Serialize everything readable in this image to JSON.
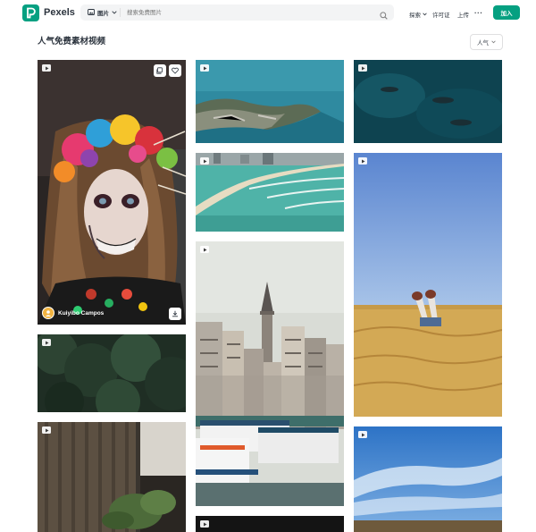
{
  "brand": {
    "name": "Pexels",
    "logo_icon": "pexels-logo-icon",
    "accent": "#05a081"
  },
  "search": {
    "filter_label": "图片",
    "filter_icon": "image-icon",
    "placeholder": "搜索免费图片"
  },
  "nav": {
    "explore": "探索",
    "license": "许可证",
    "upload": "上传",
    "more": "···",
    "join": "加入"
  },
  "page": {
    "title": "人气免费素材视频",
    "sort_label": "人气"
  },
  "tiles": [
    {
      "type": "video",
      "subject": "portrait-skull-makeup",
      "author": "Kuiyibo Campos"
    },
    {
      "type": "video",
      "subject": "forest"
    },
    {
      "type": "video",
      "subject": "curtain-plant"
    },
    {
      "type": "video",
      "subject": "coastline-aerial"
    },
    {
      "type": "video",
      "subject": "beach-aerial"
    },
    {
      "type": "video",
      "subject": "istanbul-galata-tower"
    },
    {
      "type": "video",
      "subject": "dark-scene"
    },
    {
      "type": "video",
      "subject": "sea-whales"
    },
    {
      "type": "video",
      "subject": "wheat-field-legs"
    },
    {
      "type": "video",
      "subject": "sky-clouds"
    }
  ]
}
